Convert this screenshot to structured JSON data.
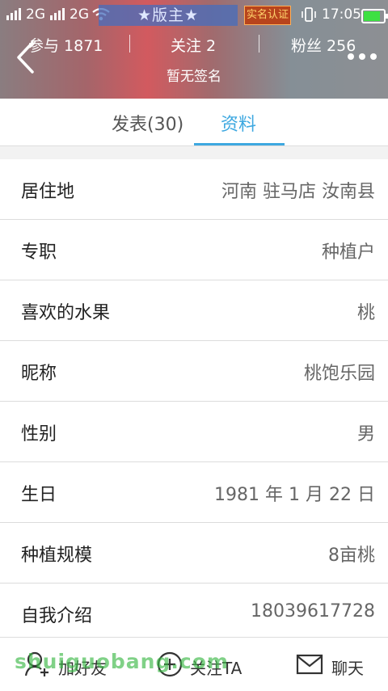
{
  "status_bar": {
    "signal1": "2G",
    "signal2": "2G",
    "title_badge": "★版主★",
    "real_name_badge": "实名认证",
    "time": "17:05"
  },
  "profile": {
    "participate": "参与 1871",
    "follow": "关注 2",
    "fans": "粉丝 256",
    "signature": "暂无签名"
  },
  "tabs": [
    {
      "label": "发表(30)"
    },
    {
      "label": "资料"
    }
  ],
  "info": [
    {
      "key": "居住地",
      "value": "河南 驻马店 汝南县"
    },
    {
      "key": "专职",
      "value": "种植户"
    },
    {
      "key": "喜欢的水果",
      "value": "桃"
    },
    {
      "key": "昵称",
      "value": "桃饱乐园"
    },
    {
      "key": "性别",
      "value": "男"
    },
    {
      "key": "生日",
      "value": "1981 年 1 月 22 日"
    },
    {
      "key": "种植规模",
      "value": "8亩桃"
    },
    {
      "key": "自我介绍",
      "value": "18039617728"
    }
  ],
  "bottom_bar": {
    "add_friend": "加好友",
    "follow": "关注TA",
    "chat": "聊天"
  },
  "watermark": "shuiguobang.com",
  "colors": {
    "accent": "#3ea8e0",
    "battery": "#3ee043"
  }
}
